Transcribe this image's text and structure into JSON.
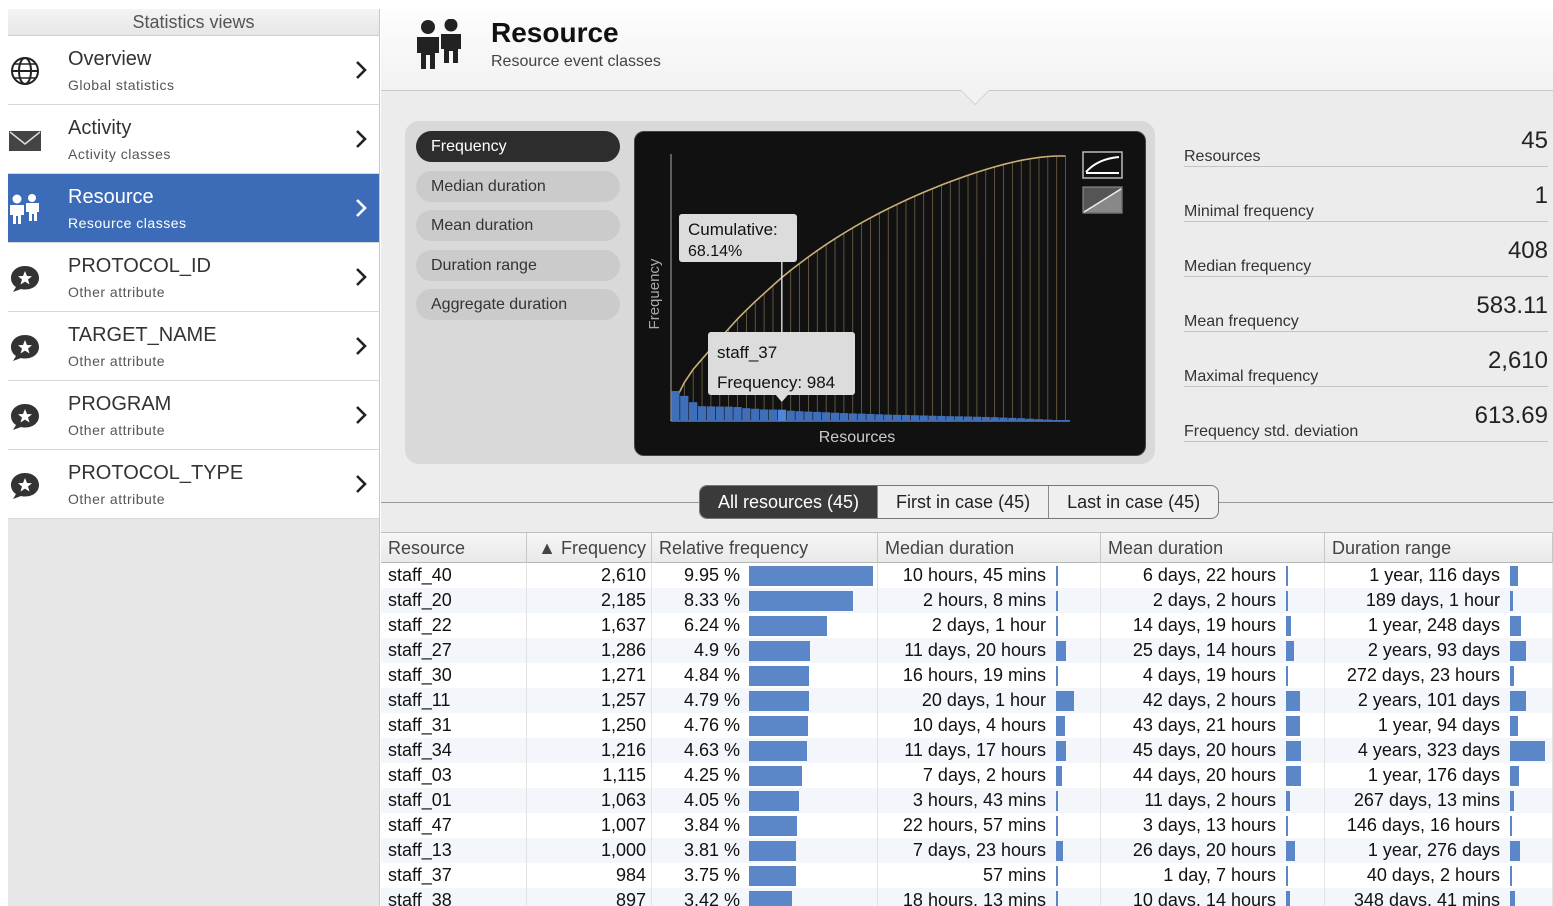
{
  "sidebar": {
    "header": "Statistics views",
    "items": [
      {
        "title": "Overview",
        "subtitle": "Global statistics",
        "icon": "globe-icon"
      },
      {
        "title": "Activity",
        "subtitle": "Activity classes",
        "icon": "envelope-icon"
      },
      {
        "title": "Resource",
        "subtitle": "Resource classes",
        "icon": "people-icon",
        "active": true
      },
      {
        "title": "PROTOCOL_ID",
        "subtitle": "Other attribute",
        "icon": "star-bubble-icon"
      },
      {
        "title": "TARGET_NAME",
        "subtitle": "Other attribute",
        "icon": "star-bubble-icon"
      },
      {
        "title": "PROGRAM",
        "subtitle": "Other attribute",
        "icon": "star-bubble-icon"
      },
      {
        "title": "PROTOCOL_TYPE",
        "subtitle": "Other attribute",
        "icon": "star-bubble-icon"
      }
    ]
  },
  "header": {
    "title": "Resource",
    "subtitle": "Resource event classes",
    "icon": "people-icon"
  },
  "metrics": {
    "buttons": [
      "Frequency",
      "Median duration",
      "Mean duration",
      "Duration range",
      "Aggregate duration"
    ],
    "active": "Frequency"
  },
  "chart_data": {
    "type": "bar",
    "xlabel": "Resources",
    "ylabel": "Frequency",
    "values": [
      2610,
      2185,
      1637,
      1286,
      1271,
      1257,
      1250,
      1216,
      1115,
      1063,
      1007,
      1000,
      984,
      897,
      850,
      820,
      790,
      760,
      720,
      690,
      660,
      640,
      610,
      580,
      560,
      540,
      520,
      500,
      480,
      460,
      440,
      420,
      408,
      390,
      370,
      350,
      330,
      300,
      270,
      240,
      200,
      160,
      120,
      60,
      1
    ],
    "cumulative_line": true,
    "tooltip_cumulative": {
      "label": "Cumulative:",
      "value": "68.14%"
    },
    "tooltip_bar": {
      "name": "staff_37",
      "value_label": "Frequency: 984"
    },
    "highlight_index": 12,
    "icons": [
      "cumulative-curve-icon",
      "distribution-icon"
    ]
  },
  "stats": [
    {
      "label": "Resources",
      "value": "45"
    },
    {
      "label": "Minimal frequency",
      "value": "1"
    },
    {
      "label": "Median frequency",
      "value": "408"
    },
    {
      "label": "Mean frequency",
      "value": "583.11"
    },
    {
      "label": "Maximal frequency",
      "value": "2,610"
    },
    {
      "label": "Frequency std. deviation",
      "value": "613.69"
    }
  ],
  "tabs": [
    {
      "label": "All resources (45)",
      "active": true
    },
    {
      "label": "First in case (45)",
      "active": false
    },
    {
      "label": "Last in case (45)",
      "active": false
    }
  ],
  "table": {
    "columns": [
      "Resource",
      "▲ Frequency",
      "Relative frequency",
      "Median duration",
      "Mean duration",
      "Duration range"
    ],
    "rows": [
      {
        "resource": "staff_40",
        "frequency": "2,610",
        "relative": "9.95 %",
        "rel_pct": 9.95,
        "median": "10 hours, 45 mins",
        "median_rel": 0.05,
        "mean": "6 days, 22 hours",
        "mean_rel": 0.1,
        "range": "1 year, 116 days",
        "range_rel": 0.22
      },
      {
        "resource": "staff_20",
        "frequency": "2,185",
        "relative": "8.33 %",
        "rel_pct": 8.33,
        "median": "2 hours, 8 mins",
        "median_rel": 0.02,
        "mean": "2 days, 2 hours",
        "mean_rel": 0.03,
        "range": "189 days, 1 hour",
        "range_rel": 0.08
      },
      {
        "resource": "staff_22",
        "frequency": "1,637",
        "relative": "6.24 %",
        "rel_pct": 6.24,
        "median": "2 days, 1 hour",
        "median_rel": 0.1,
        "mean": "14 days, 19 hours",
        "mean_rel": 0.33,
        "range": "1 year, 248 days",
        "range_rel": 0.3
      },
      {
        "resource": "staff_27",
        "frequency": "1,286",
        "relative": "4.9 %",
        "rel_pct": 4.9,
        "median": "11 days, 20 hours",
        "median_rel": 0.55,
        "mean": "25 days, 14 hours",
        "mean_rel": 0.56,
        "range": "2 years, 93 days",
        "range_rel": 0.45
      },
      {
        "resource": "staff_30",
        "frequency": "1,271",
        "relative": "4.84 %",
        "rel_pct": 4.84,
        "median": "16 hours, 19 mins",
        "median_rel": 0.05,
        "mean": "4 days, 19 hours",
        "mean_rel": 0.1,
        "range": "272 days, 23 hours",
        "range_rel": 0.12
      },
      {
        "resource": "staff_11",
        "frequency": "1,257",
        "relative": "4.79 %",
        "rel_pct": 4.79,
        "median": "20 days, 1 hour",
        "median_rel": 1.0,
        "mean": "42 days, 2 hours",
        "mean_rel": 0.92,
        "range": "2 years, 101 days",
        "range_rel": 0.45
      },
      {
        "resource": "staff_31",
        "frequency": "1,250",
        "relative": "4.76 %",
        "rel_pct": 4.76,
        "median": "10 days, 4 hours",
        "median_rel": 0.5,
        "mean": "43 days, 21 hours",
        "mean_rel": 0.96,
        "range": "1 year, 94 days",
        "range_rel": 0.22
      },
      {
        "resource": "staff_34",
        "frequency": "1,216",
        "relative": "4.63 %",
        "rel_pct": 4.63,
        "median": "11 days, 17 hours",
        "median_rel": 0.55,
        "mean": "45 days, 20 hours",
        "mean_rel": 1.0,
        "range": "4 years, 323 days",
        "range_rel": 1.0
      },
      {
        "resource": "staff_03",
        "frequency": "1,115",
        "relative": "4.25 %",
        "rel_pct": 4.25,
        "median": "7 days, 2 hours",
        "median_rel": 0.35,
        "mean": "44 days, 20 hours",
        "mean_rel": 0.98,
        "range": "1 year, 176 days",
        "range_rel": 0.25
      },
      {
        "resource": "staff_01",
        "frequency": "1,063",
        "relative": "4.05 %",
        "rel_pct": 4.05,
        "median": "3 hours, 43 mins",
        "median_rel": 0.02,
        "mean": "11 days, 2 hours",
        "mean_rel": 0.25,
        "range": "267 days, 13 mins",
        "range_rel": 0.12
      },
      {
        "resource": "staff_47",
        "frequency": "1,007",
        "relative": "3.84 %",
        "rel_pct": 3.84,
        "median": "22 hours, 57 mins",
        "median_rel": 0.05,
        "mean": "3 days, 13 hours",
        "mean_rel": 0.08,
        "range": "146 days, 16 hours",
        "range_rel": 0.07
      },
      {
        "resource": "staff_13",
        "frequency": "1,000",
        "relative": "3.81 %",
        "rel_pct": 3.81,
        "median": "7 days, 23 hours",
        "median_rel": 0.4,
        "mean": "26 days, 20 hours",
        "mean_rel": 0.58,
        "range": "1 year, 276 days",
        "range_rel": 0.28
      },
      {
        "resource": "staff_37",
        "frequency": "984",
        "relative": "3.75 %",
        "rel_pct": 3.75,
        "median": "57 mins",
        "median_rel": 0.01,
        "mean": "1 day, 7 hours",
        "mean_rel": 0.03,
        "range": "40 days, 2 hours",
        "range_rel": 0.05
      },
      {
        "resource": "staff_38",
        "frequency": "897",
        "relative": "3.42 %",
        "rel_pct": 3.42,
        "median": "18 hours, 13 mins",
        "median_rel": 0.05,
        "mean": "10 days, 14 hours",
        "mean_rel": 0.24,
        "range": "348 days, 41 mins",
        "range_rel": 0.14
      }
    ]
  },
  "colors": {
    "accent": "#3c6cb7",
    "bar": "#5b86c7",
    "chart_bg": "#111111",
    "cumulative_line": "#c9b07a"
  }
}
